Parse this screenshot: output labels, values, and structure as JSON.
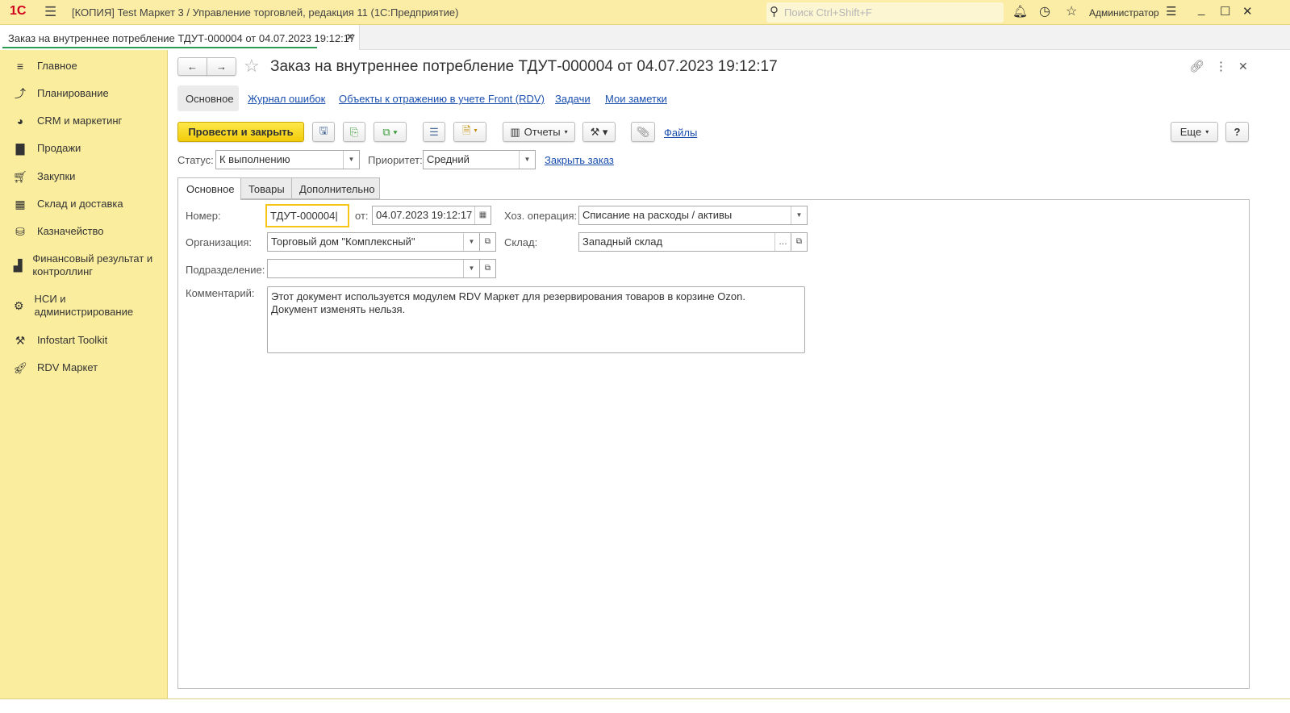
{
  "app": {
    "logo": "1С",
    "title": "[КОПИЯ] Test Маркет 3 / Управление торговлей, редакция 11  (1С:Предприятие)",
    "search_placeholder": "Поиск Ctrl+Shift+F",
    "user": "Администратор"
  },
  "open_tab": {
    "label": "Заказ на внутреннее потребление ТДУТ-000004 от 04.07.2023 19:12:17"
  },
  "sidebar": {
    "items": [
      {
        "label": "Главное",
        "icon": "menu-lines-icon"
      },
      {
        "label": "Планирование",
        "icon": "chart-line-icon"
      },
      {
        "label": "CRM и маркетинг",
        "icon": "pie-chart-icon"
      },
      {
        "label": "Продажи",
        "icon": "bag-icon"
      },
      {
        "label": "Закупки",
        "icon": "cart-icon"
      },
      {
        "label": "Склад и доставка",
        "icon": "grid-icon"
      },
      {
        "label": "Казначейство",
        "icon": "coins-icon"
      },
      {
        "label": "Финансовый результат и контроллинг",
        "icon": "bar-chart-icon"
      },
      {
        "label": "НСИ и администрирование",
        "icon": "gear-icon"
      },
      {
        "label": "Infostart Toolkit",
        "icon": "tools-icon"
      },
      {
        "label": "RDV Маркет",
        "icon": "rocket-icon"
      }
    ]
  },
  "doc": {
    "title": "Заказ на внутреннее потребление ТДУТ-000004 от 04.07.2023 19:12:17",
    "nav_links": [
      "Основное",
      "Журнал ошибок",
      "Объекты к отражению в учете Front (RDV)",
      "Задачи",
      "Мои заметки"
    ],
    "toolbar": {
      "post_close": "Провести и закрыть",
      "reports": "Отчеты",
      "files": "Файлы",
      "more": "Еще",
      "help": "?"
    },
    "status_label": "Статус:",
    "status_value": "К выполнению",
    "priority_label": "Приоритет:",
    "priority_value": "Средний",
    "close_order": "Закрыть заказ",
    "tabs": [
      "Основное",
      "Товары",
      "Дополнительно"
    ],
    "fields": {
      "number_label": "Номер:",
      "number": "ТДУТ-000004",
      "date_label": "от:",
      "date": "04.07.2023 19:12:17",
      "operation_label": "Хоз. операция:",
      "operation": "Списание на расходы / активы",
      "org_label": "Организация:",
      "org": "Торговый дом \"Комплексный\"",
      "warehouse_label": "Склад:",
      "warehouse": "Западный склад",
      "division_label": "Подразделение:",
      "division": "",
      "comment_label": "Комментарий:",
      "comment": "Этот документ используется модулем RDV Маркет для резервирования товаров в корзине Ozon.\nДокумент изменять нельзя."
    }
  },
  "colors": {
    "accent_yellow": "#fbeda6",
    "primary_button": "#f5d31a",
    "link": "#1a4fae",
    "tab_underline": "#2a9d52"
  }
}
